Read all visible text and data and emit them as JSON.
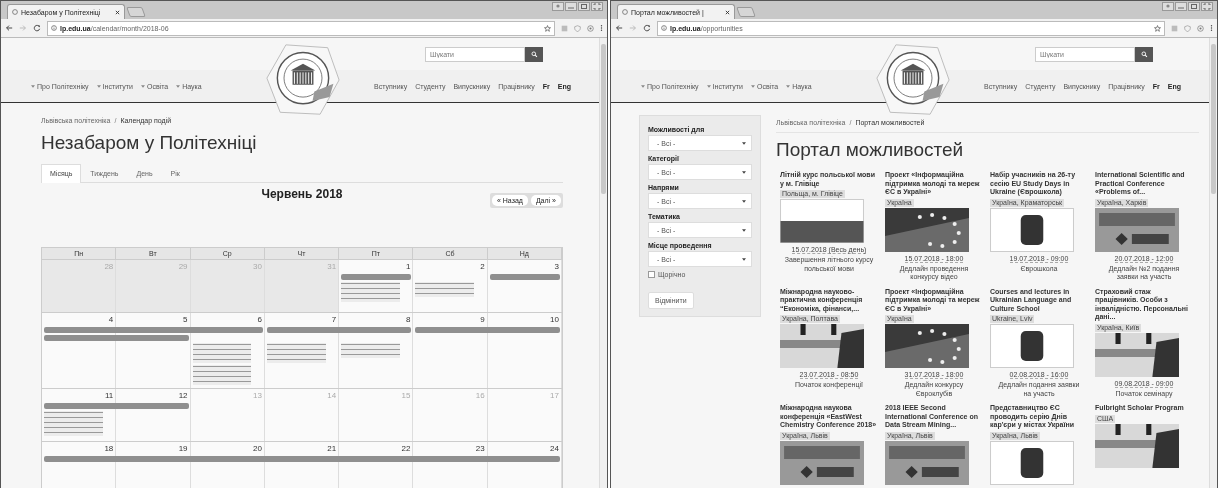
{
  "windows": [
    {
      "kind": "calendar",
      "tab_title": "Незабаром у Політехніці",
      "url_host": "lp.edu.ua",
      "url_path": "/calendar/month/2018-06",
      "search_placeholder": "Шукати",
      "nav_left": [
        "Про Політехніку",
        "Інститути",
        "Освіта",
        "Наука"
      ],
      "nav_right": [
        "Вступнику",
        "Студенту",
        "Випускнику",
        "Працівнику"
      ],
      "languages": [
        "Fr",
        "Eng"
      ],
      "breadcrumb": [
        "Львівська політехніка",
        "Календар подій"
      ],
      "breadcrumb_separator": "/",
      "heading": "Незабаром у Політехніці",
      "calendar": {
        "views": [
          {
            "label": "Місяць",
            "selected": true
          },
          {
            "label": "Тиждень",
            "selected": false
          },
          {
            "label": "День",
            "selected": false
          },
          {
            "label": "Рік",
            "selected": false
          }
        ],
        "month_title": "Червень 2018",
        "prev_button": "« Назад",
        "next_button": "Далі »",
        "weekdays": [
          "Пн",
          "Вт",
          "Ср",
          "Чт",
          "Пт",
          "Сб",
          "Нд"
        ],
        "weeks": [
          {
            "days": [
              {
                "number": "28",
                "muted": true,
                "outside": true
              },
              {
                "number": "29",
                "muted": true,
                "outside": true
              },
              {
                "number": "30",
                "muted": true,
                "outside": true
              },
              {
                "number": "31",
                "muted": true,
                "outside": true
              },
              {
                "number": "1",
                "muted": false,
                "outside": false
              },
              {
                "number": "2",
                "muted": false,
                "outside": false
              },
              {
                "number": "3",
                "muted": false,
                "outside": false
              }
            ]
          },
          {
            "days": [
              {
                "number": "4",
                "muted": false,
                "outside": false
              },
              {
                "number": "5",
                "muted": false,
                "outside": false
              },
              {
                "number": "6",
                "muted": false,
                "outside": false
              },
              {
                "number": "7",
                "muted": false,
                "outside": false
              },
              {
                "number": "8",
                "muted": false,
                "outside": false
              },
              {
                "number": "9",
                "muted": false,
                "outside": false
              },
              {
                "number": "10",
                "muted": false,
                "outside": false
              }
            ]
          },
          {
            "days": [
              {
                "number": "11",
                "muted": false,
                "outside": false
              },
              {
                "number": "12",
                "muted": false,
                "outside": false
              },
              {
                "number": "13",
                "muted": true,
                "outside": false
              },
              {
                "number": "14",
                "muted": true,
                "outside": false
              },
              {
                "number": "15",
                "muted": true,
                "outside": false
              },
              {
                "number": "16",
                "muted": true,
                "outside": false
              },
              {
                "number": "17",
                "muted": true,
                "outside": false
              }
            ]
          },
          {
            "days": [
              {
                "number": "18",
                "muted": false,
                "outside": false
              },
              {
                "number": "19",
                "muted": false,
                "outside": false
              },
              {
                "number": "20",
                "muted": false,
                "outside": false
              },
              {
                "number": "21",
                "muted": false,
                "outside": false
              },
              {
                "number": "22",
                "muted": false,
                "outside": false
              },
              {
                "number": "23",
                "muted": false,
                "outside": false
              },
              {
                "number": "24",
                "muted": false,
                "outside": false
              }
            ]
          }
        ]
      }
    },
    {
      "kind": "opportunities",
      "tab_title": "Портал можливостей |",
      "url_host": "lp.edu.ua",
      "url_path": "/opportunities",
      "search_placeholder": "Шукати",
      "nav_left": [
        "Про Політехніку",
        "Інститути",
        "Освіта",
        "Наука"
      ],
      "nav_right": [
        "Вступнику",
        "Студенту",
        "Випускнику",
        "Працівнику"
      ],
      "languages": [
        "Fr",
        "Eng"
      ],
      "breadcrumb": [
        "Львівська політехніка",
        "Портал можливостей"
      ],
      "breadcrumb_separator": "/",
      "heading": "Портал можливостей",
      "filters": [
        {
          "label": "Можливості для",
          "value": "- Всі -"
        },
        {
          "label": "Категорії",
          "value": "- Всі -"
        },
        {
          "label": "Напрями",
          "value": "- Всі -"
        },
        {
          "label": "Тематика",
          "value": "- Всі -"
        },
        {
          "label": "Місце проведення",
          "value": "- Всі -"
        }
      ],
      "yearly_checkbox": {
        "label": "Щорічно",
        "checked": false
      },
      "reset_button": "Відмінити",
      "cards": [
        {
          "kind": "flag",
          "title": "Літній курс польської мови у м. Глівіце",
          "tag": "Польща, м. Глівіце",
          "date": "15.07.2018 (Весь день)",
          "description": "Завершення літнього курсу польської мови"
        },
        {
          "kind": "stars",
          "title": "Проект «Інформаційна підтримка молоді та мереж ЄС в Україні»",
          "tag": "Україна",
          "date": "15.07.2018 - 18:00",
          "description": "Дедлайн проведення конкурсу відео"
        },
        {
          "kind": "logo",
          "title": "Набір учасників на 26-ту сесію EU Study Days in Ukraine (Єврошкола)",
          "tag": "Україна, Краматорськ",
          "date": "19.07.2018 - 09:00",
          "description": "Єврошкола"
        },
        {
          "kind": "banner",
          "title": "International Scientific and Practical Conference «Problems of...",
          "tag": "Україна, Харків",
          "date": "20.07.2018 - 12:00",
          "description": "Дедлайн №2 подання заявки на участь"
        },
        {
          "kind": "photo",
          "title": "Міжнародна науково-практична конференція “Економіка, фінанси,...",
          "tag": "Україна, Полтава",
          "date": "23.07.2018 - 08:50",
          "description": "Початок конференції"
        },
        {
          "kind": "stars",
          "title": "Проект «Інформаційна підтримка молоді та мереж ЄС в Україні»",
          "tag": "Україна",
          "date": "31.07.2018 - 18:00",
          "description": "Дедлайн конкурсу Євроклубів"
        },
        {
          "kind": "logo",
          "title": "Courses and lectures in Ukrainian Language and Culture School",
          "tag": "Ukraine, Lviv",
          "date": "02.08.2018 - 16:00",
          "description": "Дедлайн подання заявки на участь"
        },
        {
          "kind": "photo",
          "title": "Страховий стаж працівників. Особи з інвалідністю. Персональні дані...",
          "tag": "Україна, Київ",
          "date": "09.08.2018 - 09:00",
          "description": "Початок семінару"
        },
        {
          "kind": "banner",
          "title": "Міжнародна наукова конференція «EastWest Chemistry Conference 2018»",
          "tag": "Україна, Львів"
        },
        {
          "kind": "banner",
          "title": "2018 IEEE Second International Conference on Data Stream Mining...",
          "tag": "Україна, Львів"
        },
        {
          "kind": "logo",
          "title": "Представництво ЄС проводить серію Днів кар'єри у містах України",
          "tag": "Україна, Львів"
        },
        {
          "kind": "photo",
          "title": "Fulbright Scholar Program",
          "tag": "США"
        }
      ]
    }
  ]
}
